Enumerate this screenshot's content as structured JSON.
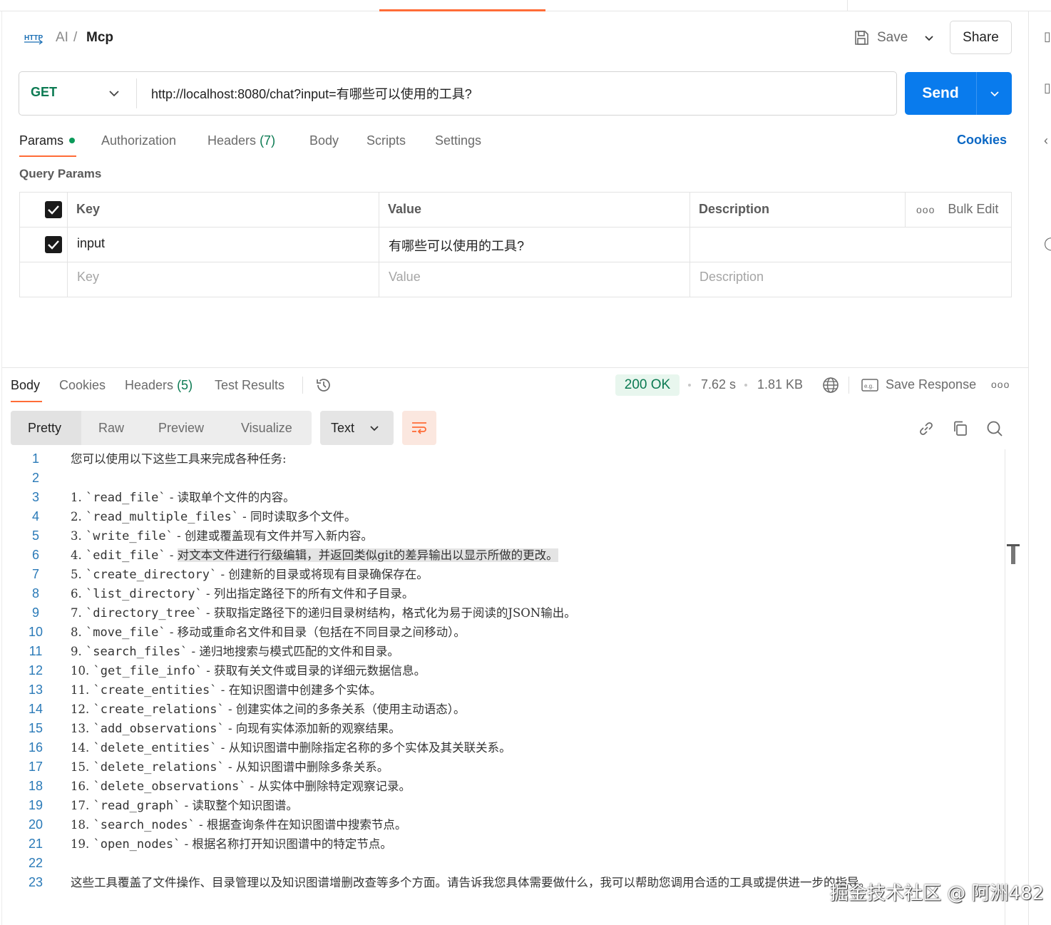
{
  "header": {
    "breadcrumb": [
      "AI",
      "/",
      "Mcp"
    ],
    "save_label": "Save",
    "share_label": "Share"
  },
  "request": {
    "method": "GET",
    "url": "http://localhost:8080/chat?input=有哪些可以使用的工具?",
    "send_label": "Send"
  },
  "request_tabs": {
    "params": "Params",
    "authorization": "Authorization",
    "headers": "Headers",
    "headers_count": "(7)",
    "body": "Body",
    "scripts": "Scripts",
    "settings": "Settings",
    "cookies": "Cookies"
  },
  "query_params": {
    "title": "Query Params",
    "columns": [
      "Key",
      "Value",
      "Description"
    ],
    "bulk_edit": "Bulk Edit",
    "rows": [
      {
        "key": "input",
        "value": "有哪些可以使用的工具?",
        "description": ""
      }
    ],
    "placeholders": {
      "key": "Key",
      "value": "Value",
      "description": "Description"
    }
  },
  "response_tabs": {
    "body": "Body",
    "cookies": "Cookies",
    "headers": "Headers",
    "headers_count": "(5)",
    "test_results": "Test Results"
  },
  "response_meta": {
    "status": "200 OK",
    "time": "7.62 s",
    "size": "1.81 KB",
    "save_response": "Save Response"
  },
  "format_bar": {
    "modes": [
      "Pretty",
      "Raw",
      "Preview",
      "Visualize"
    ],
    "active": "Pretty",
    "type": "Text"
  },
  "code_lines": [
    "您可以使用以下这些工具来完成各种任务:",
    "",
    "1. `read_file` - 读取单个文件的内容。",
    "2. `read_multiple_files` - 同时读取多个文件。",
    "3. `write_file` - 创建或覆盖现有文件并写入新内容。",
    "4. `edit_file` - 对文本文件进行行级编辑，并返回类似git的差异输出以显示所做的更改。",
    "5. `create_directory` - 创建新的目录或将现有目录确保存在。",
    "6. `list_directory` - 列出指定路径下的所有文件和子目录。",
    "7. `directory_tree` - 获取指定路径下的递归目录树结构，格式化为易于阅读的JSON输出。",
    "8. `move_file` - 移动或重命名文件和目录（包括在不同目录之间移动）。",
    "9. `search_files` - 递归地搜索与模式匹配的文件和目录。",
    "10. `get_file_info` - 获取有关文件或目录的详细元数据信息。",
    "11. `create_entities` - 在知识图谱中创建多个实体。",
    "12. `create_relations` - 创建实体之间的多条关系（使用主动语态）。",
    "13. `add_observations` - 向现有实体添加新的观察结果。",
    "14. `delete_entities` - 从知识图谱中删除指定名称的多个实体及其关联关系。",
    "15. `delete_relations` - 从知识图谱中删除多条关系。",
    "16. `delete_observations` - 从实体中删除特定观察记录。",
    "17. `read_graph` - 读取整个知识图谱。",
    "18. `search_nodes` - 根据查询条件在知识图谱中搜索节点。",
    "19. `open_nodes` - 根据名称打开知识图谱中的特定节点。",
    "",
    "这些工具覆盖了文件操作、目录管理以及知识图谱增删改查等多个方面。请告诉我您具体需要做什么，我可以帮助您调用合适的工具或提供进一步的指导。"
  ],
  "watermark": "掘金技术社区 @ 阿洲482",
  "colors": {
    "accent": "#ff6c37",
    "send": "#097bed",
    "method": "#0b7a52",
    "line_number": "#2a7ab8"
  },
  "icons": [
    "http-icon",
    "save-icon",
    "chevron-down-icon",
    "history-icon",
    "globe-icon",
    "save-response-icon",
    "more-icon",
    "wrap-icon",
    "link-icon",
    "copy-icon",
    "search-icon"
  ]
}
